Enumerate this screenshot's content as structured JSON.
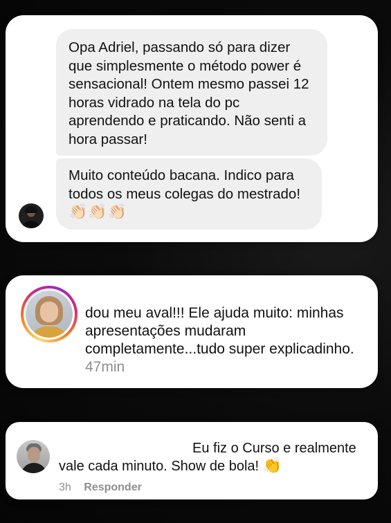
{
  "dm": {
    "message1_lines": [
      "Opa Adriel, passando só para dizer",
      "que simplesmente o método power é",
      "sensacional! Ontem mesmo passei 12",
      "horas vidrado na tela do pc",
      "aprendendo e praticando. Não senti a",
      "hora passar!"
    ],
    "message2_lines": [
      "Muito conteúdo bacana. Indico para",
      "todos os meus colegas do mestrado!"
    ],
    "message2_emoji": "👏🏻👏🏻👏🏻"
  },
  "story_reply": {
    "text": "dou meu aval!!! Ele ajuda muito: minhas apresentações mudaram completamente...tudo super explicadinho.",
    "time": "47min"
  },
  "comment": {
    "line1": "Eu fiz o Curso e realmente",
    "line2": "vale cada minuto. Show de bola!",
    "emoji": "👏",
    "time": "3h",
    "reply_label": "Responder"
  }
}
